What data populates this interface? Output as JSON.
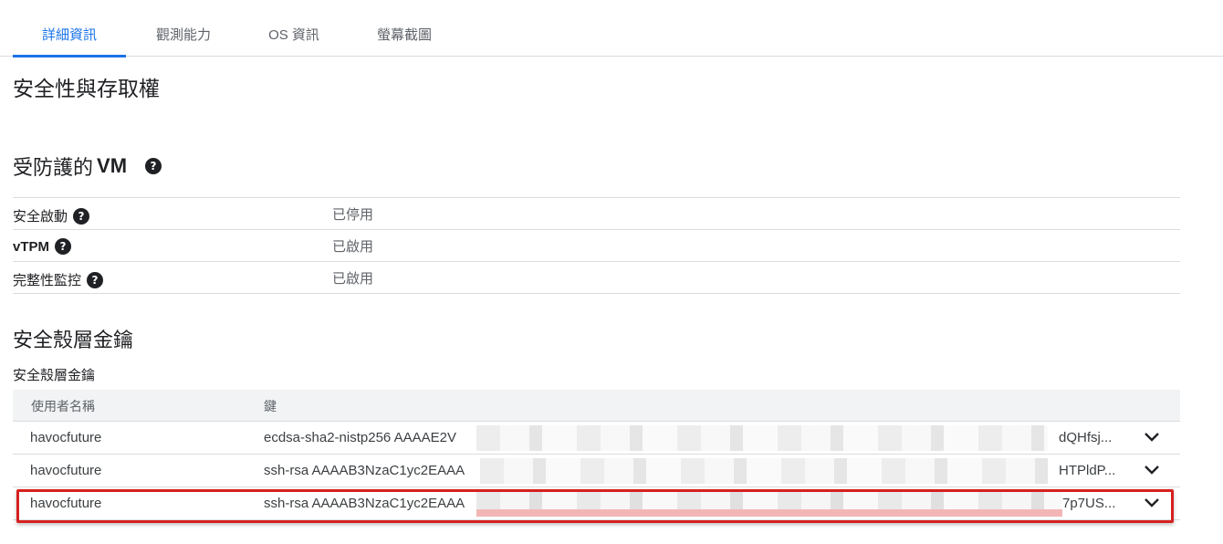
{
  "tabs": [
    {
      "label": "詳細資訊",
      "active": true
    },
    {
      "label": "觀測能力",
      "active": false
    },
    {
      "label": "OS 資訊",
      "active": false
    },
    {
      "label": "螢幕截圖",
      "active": false
    }
  ],
  "security": {
    "title": "安全性與存取權",
    "shielded_vm": {
      "title_prefix": "受防護的",
      "title_bold": "VM",
      "help_icon": "help-circle-icon",
      "rows": [
        {
          "label": "安全啟動",
          "value": "已停用"
        },
        {
          "label": "vTPM",
          "value": "已啟用"
        },
        {
          "label": "完整性監控",
          "value": "已啟用"
        }
      ]
    },
    "ssh": {
      "title": "安全殼層金鑰",
      "subtitle": "安全殼層金鑰",
      "columns": [
        "使用者名稱",
        "鍵"
      ],
      "rows": [
        {
          "user": "havocfuture",
          "key_start": "ecdsa-sha2-nistp256 AAAAE2V",
          "key_end": "dQHfsj..."
        },
        {
          "user": "havocfuture",
          "key_start": "ssh-rsa AAAAB3NzaC1yc2EAAA",
          "key_end": "HTPldP..."
        },
        {
          "user": "havocfuture",
          "key_start": "ssh-rsa AAAAB3NzaC1yc2EAAA",
          "key_end": "7p7US..."
        }
      ],
      "expand_icon": "chevron-down-icon",
      "highlight_color": "#d62020"
    }
  },
  "colors": {
    "accent": "#1a73e8",
    "text": "#202124",
    "muted": "#5f6368"
  }
}
